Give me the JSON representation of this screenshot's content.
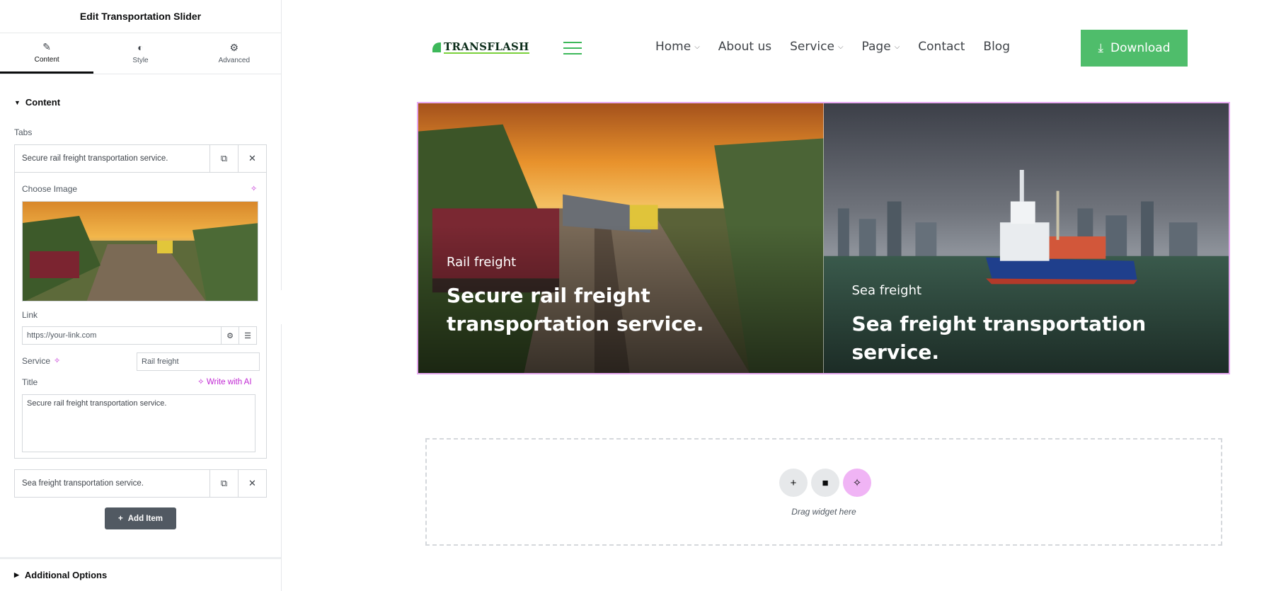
{
  "panel": {
    "title": "Edit Transportation Slider",
    "tabs": [
      {
        "label": "Content",
        "icon": "pencil-icon"
      },
      {
        "label": "Style",
        "icon": "half-circle-icon"
      },
      {
        "label": "Advanced",
        "icon": "gear-icon"
      }
    ],
    "section_title": "Content",
    "tabs_label": "Tabs",
    "items": [
      {
        "title": "Secure rail freight transportation service."
      },
      {
        "title": "Sea freight transportation service."
      }
    ],
    "choose_image_label": "Choose Image",
    "link_label": "Link",
    "link_placeholder": "https://your-link.com",
    "service_label": "Service",
    "service_value": "Rail freight",
    "title_label": "Title",
    "write_ai_label": "Write with AI",
    "title_value": "Secure rail freight transportation service.",
    "add_item_label": "Add Item",
    "additional_options_label": "Additional Options"
  },
  "site": {
    "logo_text": "TRANSFLASH",
    "nav": [
      {
        "label": "Home",
        "dropdown": true
      },
      {
        "label": "About us",
        "dropdown": false
      },
      {
        "label": "Service",
        "dropdown": true
      },
      {
        "label": "Page",
        "dropdown": true
      },
      {
        "label": "Contact",
        "dropdown": false
      },
      {
        "label": "Blog",
        "dropdown": false
      }
    ],
    "download_label": "Download",
    "accent_color": "#4fbd6b"
  },
  "slider": {
    "slides": [
      {
        "service": "Rail freight",
        "title": "Secure rail freight transportation service."
      },
      {
        "service": "Sea freight",
        "title": "Sea freight transportation service."
      }
    ]
  },
  "drop_zone": {
    "text": "Drag widget here"
  }
}
